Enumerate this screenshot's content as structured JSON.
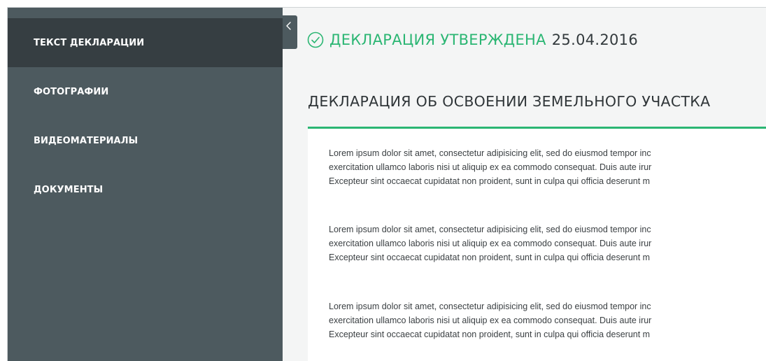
{
  "sidebar": {
    "items": [
      {
        "label": "ТЕКСТ ДЕКЛАРАЦИИ",
        "active": true
      },
      {
        "label": "ФОТОГРАФИИ",
        "active": false
      },
      {
        "label": "ВИДЕОМАТЕРИАЛЫ",
        "active": false
      },
      {
        "label": "ДОКУМЕНТЫ",
        "active": false
      }
    ],
    "collapse_icon": "chevron-left-icon"
  },
  "status": {
    "icon": "check-circle-icon",
    "label": "ДЕКЛАРАЦИЯ УТВЕРЖДЕНА",
    "date": "25.04.2016",
    "color": "#2bb673"
  },
  "document": {
    "title": "ДЕКЛАРАЦИЯ ОБ ОСВОЕНИИ ЗЕМЕЛЬНОГО УЧАСТКА",
    "accent_color": "#2bb673",
    "paragraphs": [
      {
        "lines": [
          "Lorem ipsum dolor sit amet, consectetur adipisicing elit, sed do eiusmod tempor inc",
          "exercitation ullamco laboris nisi ut aliquip ex ea commodo consequat. Duis aute irur",
          "Excepteur sint occaecat cupidatat non proident, sunt in culpa qui officia deserunt m"
        ]
      },
      {
        "lines": [
          "Lorem ipsum dolor sit amet, consectetur adipisicing elit, sed do eiusmod tempor inc",
          "exercitation ullamco laboris nisi ut aliquip ex ea commodo consequat. Duis aute irur",
          "Excepteur sint occaecat cupidatat non proident, sunt in culpa qui officia deserunt m"
        ]
      },
      {
        "lines": [
          "Lorem ipsum dolor sit amet, consectetur adipisicing elit, sed do eiusmod tempor inc",
          "exercitation ullamco laboris nisi ut aliquip ex ea commodo consequat. Duis aute irur",
          "Excepteur sint occaecat cupidatat non proident, sunt in culpa qui officia deserunt m"
        ]
      }
    ]
  }
}
